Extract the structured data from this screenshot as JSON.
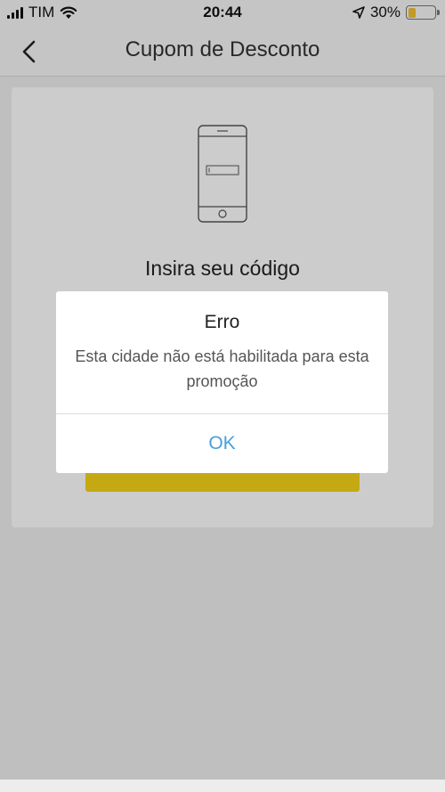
{
  "status_bar": {
    "carrier": "TIM",
    "time": "20:44",
    "battery_percent": "30%",
    "battery_level": 0.3,
    "battery_color": "#f2c230",
    "icons": [
      "signal-icon",
      "wifi-icon",
      "location-arrow-icon",
      "battery-icon"
    ]
  },
  "nav": {
    "title": "Cupom de Desconto",
    "back_icon": "chevron-left-icon"
  },
  "card": {
    "illustration_icon": "phone-with-code-field-icon",
    "heading": "Insira seu código"
  },
  "alert": {
    "title": "Erro",
    "message": "Esta cidade não está habilitada para esta promoção",
    "ok_label": "OK",
    "ok_color": "#4a9fd8"
  },
  "colors": {
    "accent_yellow": "#f5d418"
  }
}
